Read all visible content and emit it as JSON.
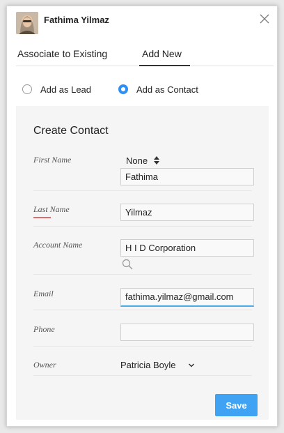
{
  "header": {
    "user_name": "Fathima Yilmaz",
    "avatar_icon": "user-photo",
    "close_icon": "close-icon"
  },
  "tabs": [
    {
      "label": "Associate to Existing",
      "active": false
    },
    {
      "label": "Add New",
      "active": true
    }
  ],
  "radio_options": [
    {
      "label": "Add as Lead",
      "checked": false
    },
    {
      "label": "Add as Contact",
      "checked": true
    }
  ],
  "form": {
    "title": "Create Contact",
    "fields": {
      "first_name": {
        "label": "First Name",
        "salutation": "None",
        "value": "Fathima"
      },
      "last_name": {
        "label": "Last Name",
        "value": "Yilmaz",
        "required": true
      },
      "account_name": {
        "label": "Account Name",
        "value": "H I D Corporation"
      },
      "email": {
        "label": "Email",
        "value": "fathima.yilmaz@gmail.com"
      },
      "phone": {
        "label": "Phone",
        "value": ""
      },
      "owner": {
        "label": "Owner",
        "value": "Patricia Boyle"
      }
    },
    "save_label": "Save"
  },
  "colors": {
    "accent": "#3fa2f2",
    "radio_checked": "#2f8ff3",
    "required_marker": "#e46a6a",
    "focus_underline": "#4aa9e9"
  }
}
